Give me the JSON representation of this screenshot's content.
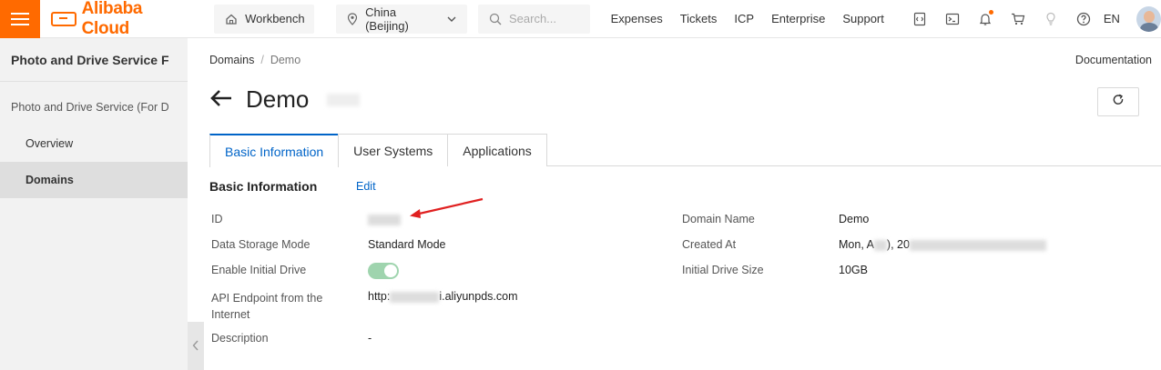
{
  "topbar": {
    "logo_text": "Alibaba Cloud",
    "workbench_label": "Workbench",
    "region_label": "China (Beijing)",
    "search_placeholder": "Search...",
    "nav_links": [
      "Expenses",
      "Tickets",
      "ICP",
      "Enterprise",
      "Support"
    ],
    "language": "EN",
    "accent_color": "#ff6a00"
  },
  "sidebar": {
    "title": "Photo and Drive Service F",
    "group_label": "Photo and Drive Service (For D",
    "items": [
      {
        "label": "Overview",
        "active": false
      },
      {
        "label": "Domains",
        "active": true
      }
    ]
  },
  "breadcrumb": {
    "parent": "Domains",
    "separator": "/",
    "current": "Demo"
  },
  "documentation_label": "Documentation",
  "page_title": "Demo",
  "tabs": [
    {
      "label": "Basic Information",
      "active": true
    },
    {
      "label": "User Systems",
      "active": false
    },
    {
      "label": "Applications",
      "active": false
    }
  ],
  "section": {
    "title": "Basic Information",
    "edit_label": "Edit"
  },
  "fields_left": {
    "id_label": "ID",
    "storage_label": "Data Storage Mode",
    "storage_value": "Standard Mode",
    "drive_label": "Enable Initial Drive",
    "endpoint_label_line1": "API Endpoint from the",
    "endpoint_label_line2": "Internet",
    "endpoint_value_prefix": "http:",
    "endpoint_value_suffix": "i.aliyunpds.com",
    "description_label": "Description",
    "description_value": "-"
  },
  "fields_right": {
    "domain_name_label": "Domain Name",
    "domain_name_value": "Demo",
    "created_label": "Created At",
    "created_value_prefix": "Mon, A",
    "created_value_mid": "), 20",
    "drive_size_label": "Initial Drive Size",
    "drive_size_value": "10GB"
  },
  "colors": {
    "link": "#0064c8",
    "toggle_on": "#9fd4ae",
    "annotation_arrow": "#e02020"
  }
}
